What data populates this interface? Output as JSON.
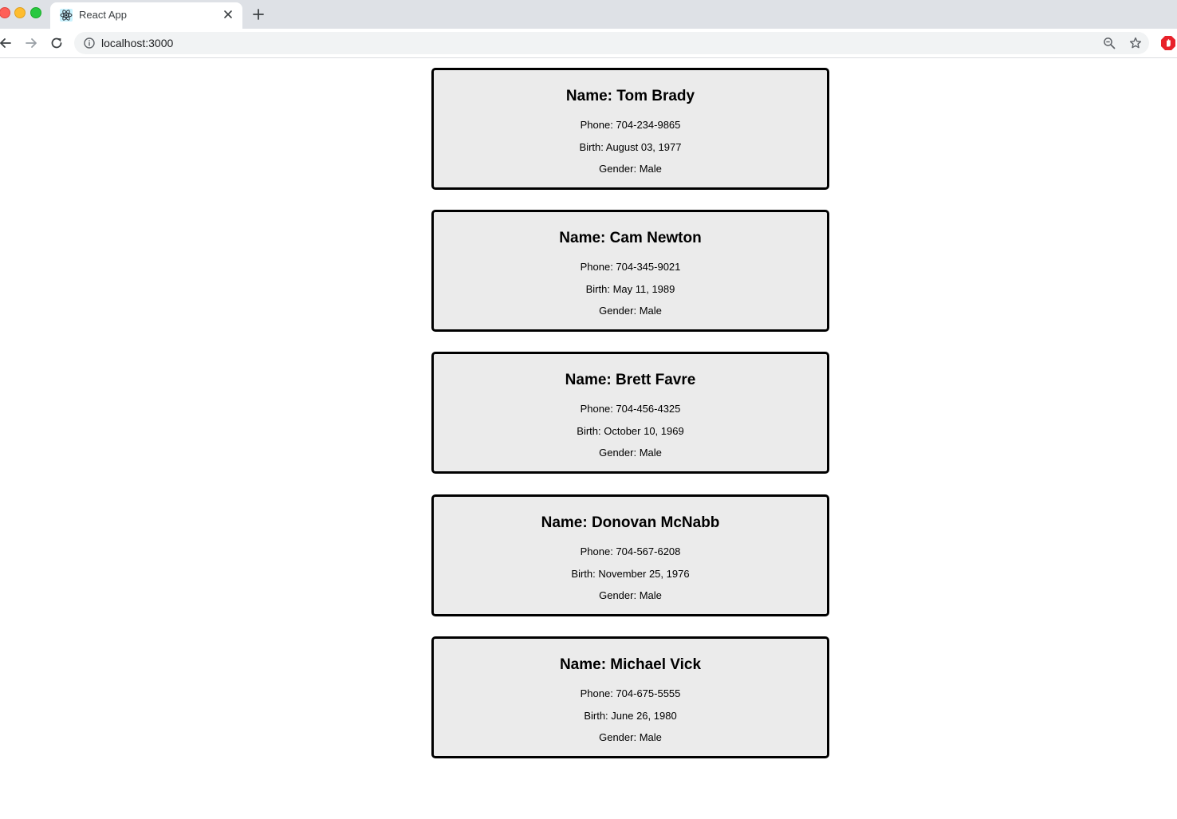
{
  "browser": {
    "tab_title": "React App",
    "url": "localhost:3000"
  },
  "cards": [
    {
      "name": "Name: Tom Brady",
      "phone": "Phone: 704-234-9865",
      "birth": "Birth: August 03, 1977",
      "gender": "Gender: Male"
    },
    {
      "name": "Name: Cam Newton",
      "phone": "Phone: 704-345-9021",
      "birth": "Birth: May 11, 1989",
      "gender": "Gender: Male"
    },
    {
      "name": "Name: Brett Favre",
      "phone": "Phone: 704-456-4325",
      "birth": "Birth: October 10, 1969",
      "gender": "Gender: Male"
    },
    {
      "name": "Name: Donovan McNabb",
      "phone": "Phone: 704-567-6208",
      "birth": "Birth: November 25, 1976",
      "gender": "Gender: Male"
    },
    {
      "name": "Name: Michael Vick",
      "phone": "Phone: 704-675-5555",
      "birth": "Birth: June 26, 1980",
      "gender": "Gender: Male"
    }
  ],
  "icons": {
    "favicon": "react-logo-icon",
    "tab_close": "close-icon",
    "new_tab": "plus-icon",
    "back": "arrow-left-icon",
    "forward": "arrow-right-icon",
    "reload": "reload-icon",
    "site_info": "info-icon",
    "zoom": "zoom-icon",
    "bookmark": "star-icon",
    "extension": "adblock-icon"
  }
}
